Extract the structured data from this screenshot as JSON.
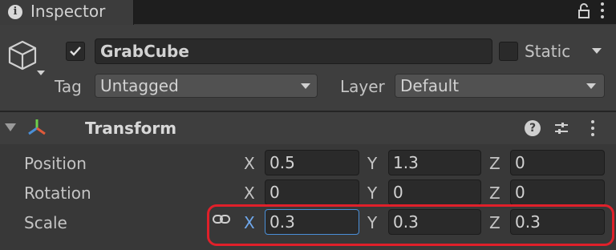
{
  "tab": {
    "title": "Inspector"
  },
  "object": {
    "active": true,
    "name": "GrabCube",
    "static_label": "Static",
    "static_checked": false
  },
  "tag": {
    "label": "Tag",
    "value": "Untagged"
  },
  "layer": {
    "label": "Layer",
    "value": "Default"
  },
  "transform": {
    "title": "Transform",
    "rows": [
      {
        "label": "Position",
        "x": "0.5",
        "y": "1.3",
        "z": "0"
      },
      {
        "label": "Rotation",
        "x": "0",
        "y": "0",
        "z": "0"
      },
      {
        "label": "Scale",
        "x": "0.3",
        "y": "0.3",
        "z": "0.3"
      }
    ],
    "axes": {
      "x": "X",
      "y": "Y",
      "z": "Z"
    }
  },
  "colors": {
    "highlight": "#e0202a",
    "focus": "#4a8fd8",
    "axis_x_active": "#6fa8ec"
  }
}
